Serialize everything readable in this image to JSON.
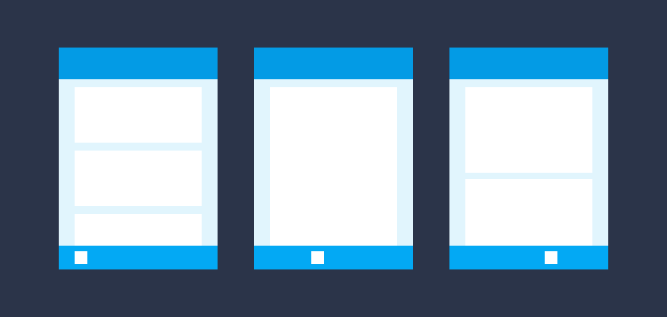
{
  "colors": {
    "background": "#2b3449",
    "app_bar": "#039be5",
    "bottom_bar": "#03a9f4",
    "content_area": "#e1f5fd",
    "card": "#ffffff",
    "nav_icon": "#ffffff"
  },
  "phones": [
    {
      "cards": 3,
      "nav_icon_position": "left"
    },
    {
      "cards": 1,
      "nav_icon_position": "center"
    },
    {
      "cards": 2,
      "nav_icon_position": "right"
    }
  ]
}
